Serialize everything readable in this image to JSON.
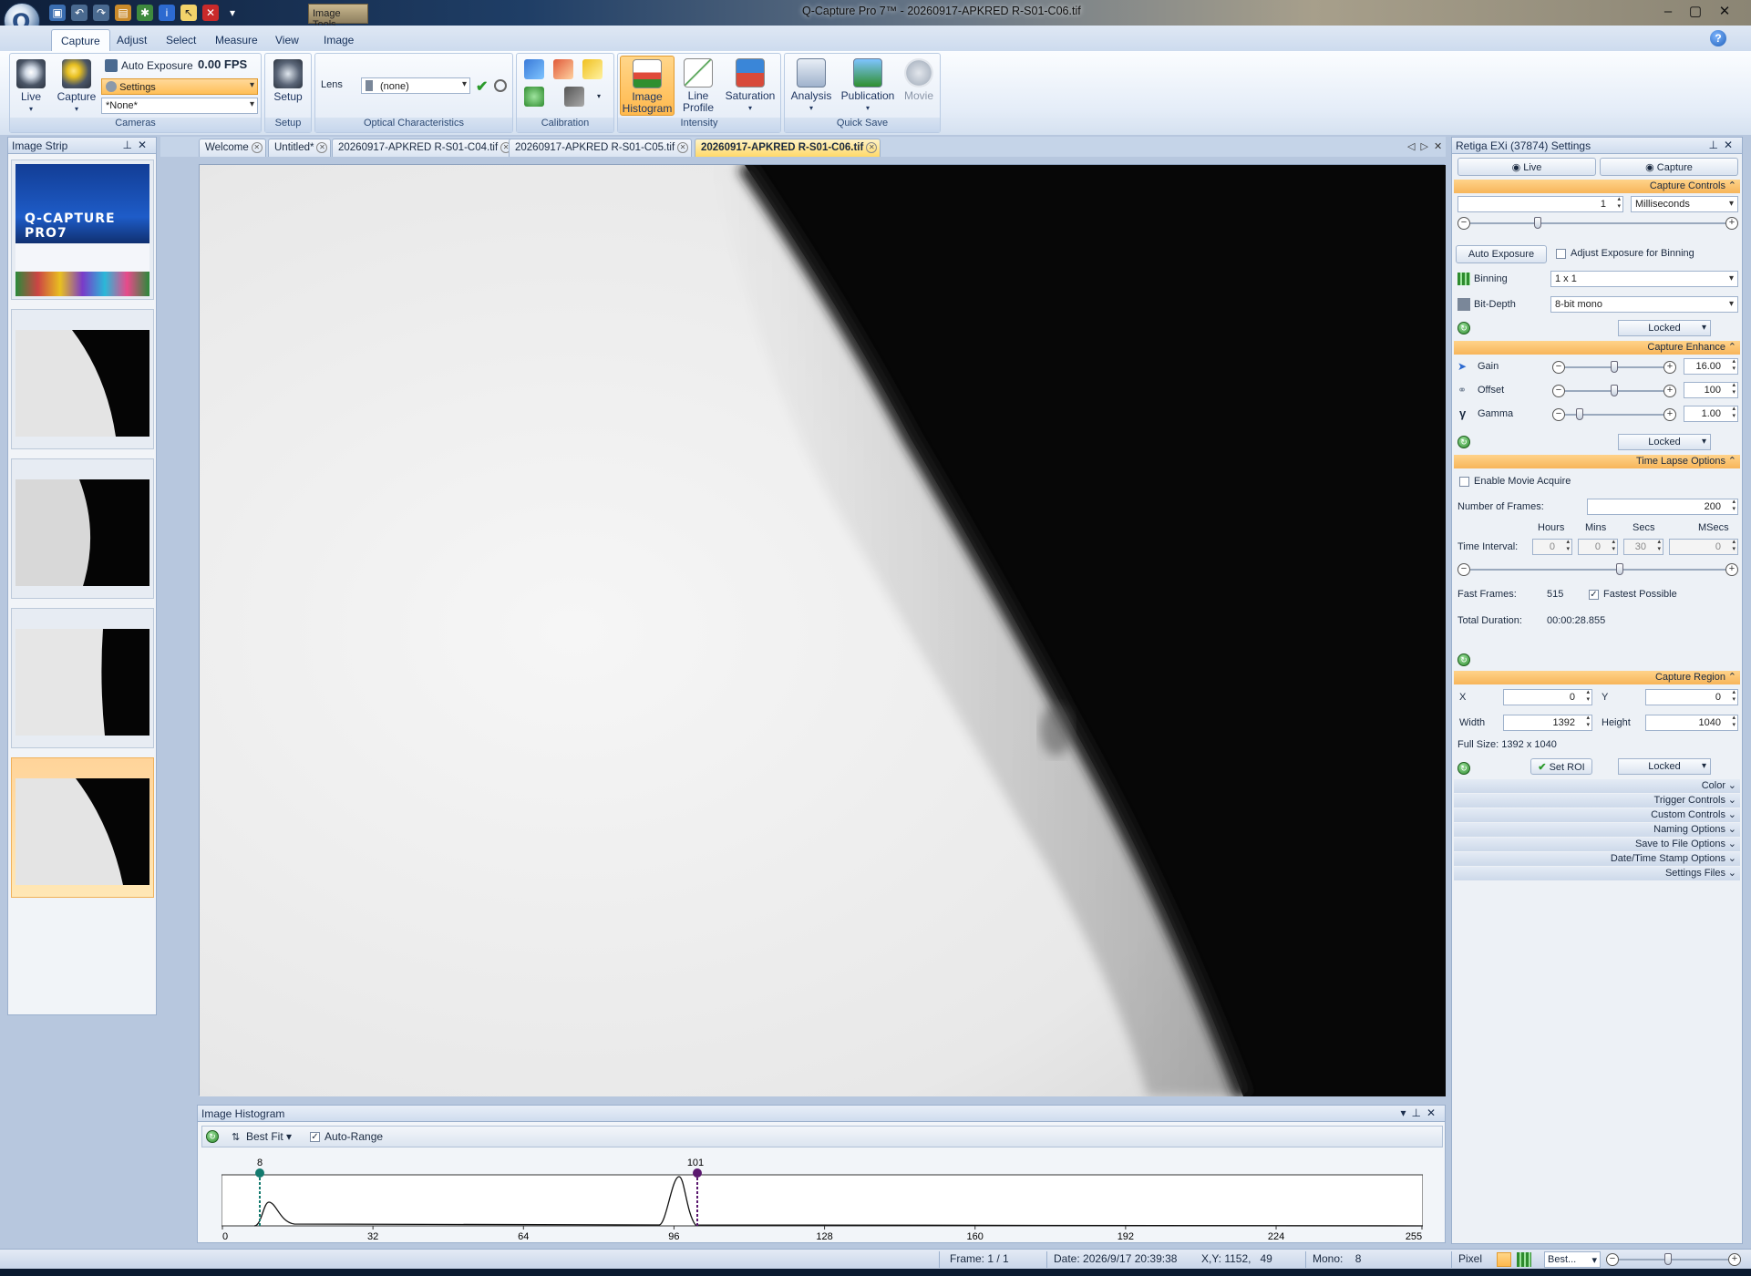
{
  "window": {
    "title": "Q-Capture Pro 7™ - 20260917-APKRED R-S01-C06.tif",
    "context_tab": "Image Tools"
  },
  "ribbon": {
    "tabs": [
      "Capture",
      "Adjust",
      "Select",
      "Measure",
      "View",
      "Image"
    ],
    "active_tab": "Capture",
    "cameras": {
      "caption": "Cameras",
      "live_label": "Live",
      "capture_label": "Capture",
      "auto_exposure_label": "Auto Exposure",
      "fps": "0.00 FPS",
      "settings_label": "Settings",
      "preset_value": "*None*"
    },
    "setup": {
      "caption": "Setup",
      "button_label": "Setup"
    },
    "optical": {
      "caption": "Optical Characteristics",
      "lens_label": "Lens",
      "lens_value": "(none)"
    },
    "calibration": {
      "caption": "Calibration"
    },
    "intensity": {
      "caption": "Intensity",
      "histogram_label_1": "Image",
      "histogram_label_2": "Histogram",
      "lineprofile_label_1": "Line",
      "lineprofile_label_2": "Profile",
      "saturation_label": "Saturation"
    },
    "quicksave": {
      "caption": "Quick Save",
      "analysis_label": "Analysis",
      "publication_label": "Publication",
      "movie_label": "Movie"
    }
  },
  "image_strip": {
    "title": "Image Strip",
    "splash_title": "Q-CAPTURE PRO7"
  },
  "doc_tabs": [
    {
      "label": "Welcome"
    },
    {
      "label": "Untitled*"
    },
    {
      "label": "20260917-APKRED R-S01-C04.tif"
    },
    {
      "label": "20260917-APKRED R-S01-C05.tif"
    },
    {
      "label": "20260917-APKRED R-S01-C06.tif"
    }
  ],
  "histogram": {
    "title": "Image Histogram",
    "fit_label": "Best Fit",
    "autorange_label": "Auto-Range",
    "autorange_checked": true,
    "low_marker": "8",
    "high_marker": "101",
    "ticks": [
      "0",
      "32",
      "64",
      "96",
      "128",
      "160",
      "192",
      "224",
      "255"
    ]
  },
  "settings": {
    "title": "Retiga EXi (37874) Settings",
    "live_label": "Live",
    "capture_label": "Capture",
    "capture_controls": {
      "header": "Capture Controls",
      "exposure_value": "1",
      "exposure_unit": "Milliseconds",
      "auto_exposure_button": "Auto Exposure",
      "adjust_binning_label": "Adjust Exposure for Binning",
      "binning_label": "Binning",
      "binning_value": "1 x 1",
      "bitdepth_label": "Bit-Depth",
      "bitdepth_value": "8-bit mono",
      "locked_label": "Locked"
    },
    "capture_enhance": {
      "header": "Capture Enhance",
      "gain_label": "Gain",
      "gain_value": "16.00",
      "offset_label": "Offset",
      "offset_value": "100",
      "gamma_label": "Gamma",
      "gamma_value": "1.00",
      "locked_label": "Locked"
    },
    "time_lapse": {
      "header": "Time Lapse Options",
      "enable_movie_label": "Enable Movie Acquire",
      "frames_label": "Number of Frames:",
      "frames_value": "200",
      "hours_label": "Hours",
      "mins_label": "Mins",
      "secs_label": "Secs",
      "msecs_label": "MSecs",
      "interval_label": "Time Interval:",
      "hours_value": "0",
      "mins_value": "0",
      "secs_value": "30",
      "msecs_value": "0",
      "fast_frames_label": "Fast Frames:",
      "fast_frames_value": "515",
      "fastest_label": "Fastest Possible",
      "total_duration_label": "Total Duration:",
      "total_duration_value": "00:00:28.855"
    },
    "capture_region": {
      "header": "Capture Region",
      "x_label": "X",
      "x_value": "0",
      "y_label": "Y",
      "y_value": "0",
      "width_label": "Width",
      "width_value": "1392",
      "height_label": "Height",
      "height_value": "1040",
      "full_size": "Full Size: 1392 x 1040",
      "set_roi_label": "Set ROI",
      "locked_label": "Locked"
    },
    "collapsed_sections": [
      "Color",
      "Trigger Controls",
      "Custom Controls",
      "Naming Options",
      "Save to File Options",
      "Date/Time Stamp Options",
      "Settings Files"
    ]
  },
  "status": {
    "frame": "Frame: 1 / 1",
    "date": "Date: 2026/9/17 20:39:38",
    "xy": "X,Y: 1152,   49",
    "mono": "Mono:    8",
    "pixel": "Pixel",
    "zoom": "Best..."
  }
}
